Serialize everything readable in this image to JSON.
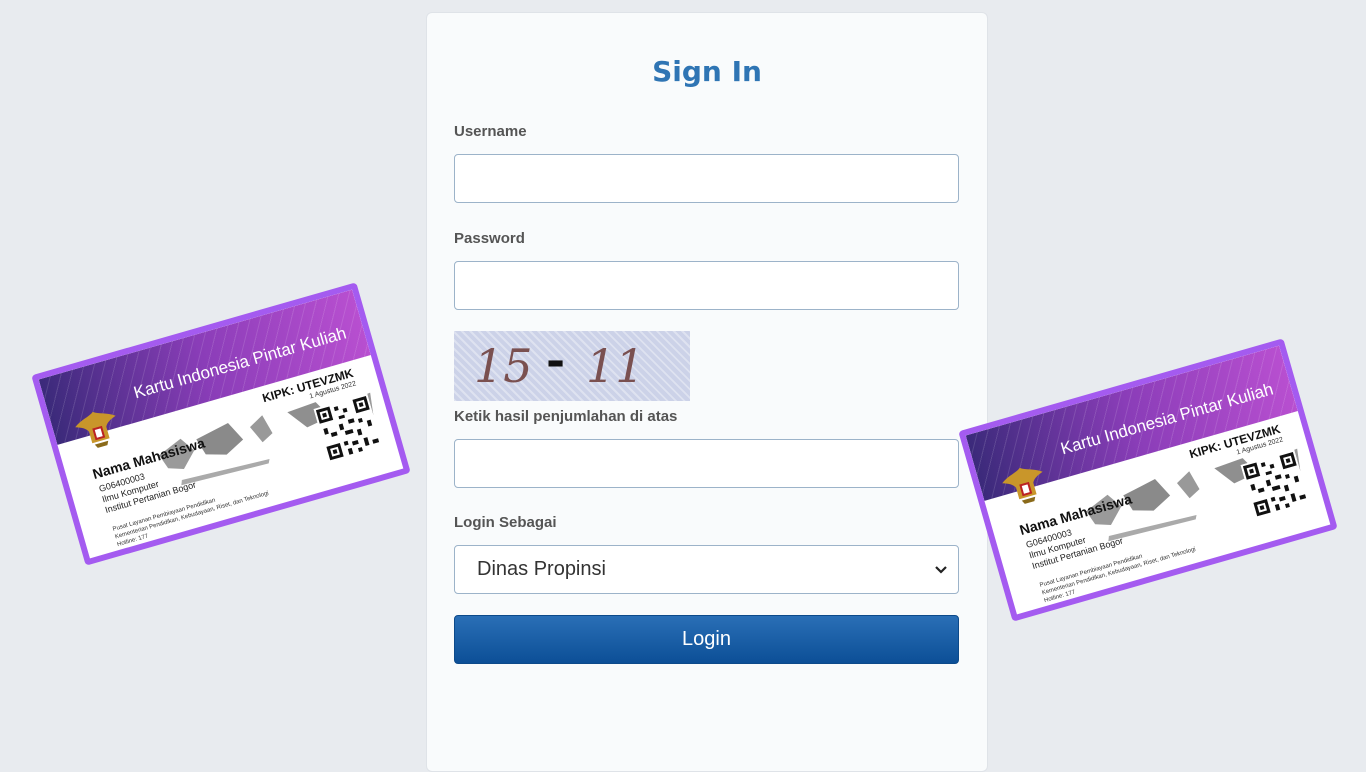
{
  "form": {
    "title": "Sign In",
    "username_label": "Username",
    "username_value": "",
    "password_label": "Password",
    "password_value": "",
    "captcha": {
      "left": "15",
      "operator": "-",
      "right": "11"
    },
    "captcha_label": "Ketik hasil penjumlahan di atas",
    "captcha_value": "",
    "role_label": "Login Sebagai",
    "role_selected": "Dinas Propinsi",
    "login_button": "Login"
  },
  "card": {
    "title": "Kartu Indonesia Pintar Kuliah",
    "kipk": "KIPK: UTEVZMK",
    "date": "1 Agustus 2022",
    "name": "Nama Mahasiswa",
    "id": "G06400003",
    "program": "Ilmu Komputer",
    "institution": "Institut Pertanian Bogor",
    "footer1": "Pusat Layanan Pembiayaan Pendidikan",
    "footer2": "Kementerian Pendidikan, Kebudayaan, Riset, dan Teknologi",
    "hotline": "Hotline: 177"
  },
  "colors": {
    "accent": "#2f75b4",
    "button": "#0c4f97",
    "card_border": "#a45bf0"
  },
  "icons": [
    "chevron-down-icon",
    "garuda-emblem-icon",
    "qr-code-icon"
  ]
}
